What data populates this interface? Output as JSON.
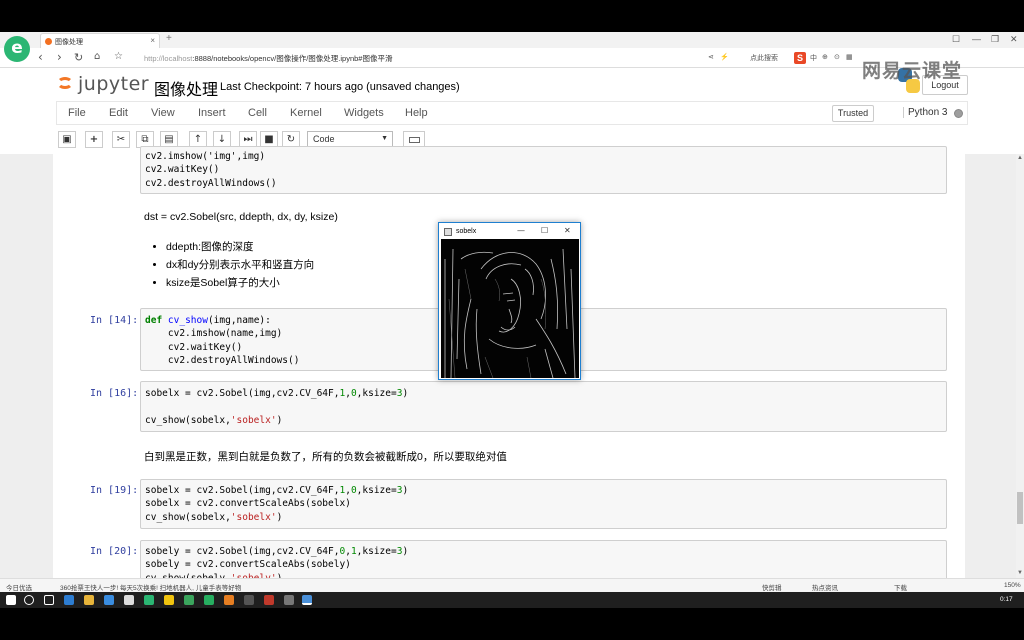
{
  "browser": {
    "tab_title": "图像处理",
    "url_host": "http://localhost",
    "url_path": ":8888/notebooks/opencv/图像操作/图像处理.ipynb#图像平滑",
    "new_tab_symbol": "+",
    "tab_close_symbol": "×",
    "right_tools": [
      "点此搜索",
      "中",
      "⊕",
      "⊙",
      "▦"
    ],
    "window_controls": [
      "☐",
      "—",
      "❐",
      "✕"
    ]
  },
  "jupyter": {
    "logo_text": "jupyter",
    "notebook_name": "图像处理",
    "checkpoint": "Last Checkpoint: 7 hours ago (unsaved changes)",
    "logout": "Logout",
    "menu": [
      "File",
      "Edit",
      "View",
      "Insert",
      "Cell",
      "Kernel",
      "Widgets",
      "Help"
    ],
    "trusted": "Trusted",
    "kernel": "Python 3",
    "cell_type": "Code",
    "toolbar_icons": [
      "save-icon",
      "plus-icon",
      "cut-icon",
      "copy-icon",
      "paste-icon",
      "arrow-up-icon",
      "arrow-down-icon",
      "run-icon",
      "stop-icon",
      "restart-icon"
    ]
  },
  "watermark": "网易云课堂",
  "cells": {
    "top_code": [
      "cv2.imshow('img',img)",
      "cv2.waitKey()",
      "cv2.destroyAllWindows()"
    ],
    "md1_heading": "dst = cv2.Sobel(src, ddepth, dx, dy, ksize)",
    "md1_bullets": [
      "ddepth:图像的深度",
      "dx和dy分别表示水平和竖直方向",
      "ksize是Sobel算子的大小"
    ],
    "c14_prompt": "In [14]:",
    "c16_prompt": "In [16]:",
    "md2_text": "白到黑是正数，黑到白就是负数了，所有的负数会被截断成0，所以要取绝对值",
    "c19_prompt": "In [19]:",
    "c20_prompt": "In [20]:"
  },
  "cv_window": {
    "title": "sobelx",
    "controls": [
      "—",
      "☐",
      "✕"
    ]
  },
  "statusbar": {
    "left": "今日优选",
    "news": "360抢票王快人一步! 每天5次换乘! 扫地机器人, 儿童手表等好物",
    "items": [
      "快剪辑",
      "热点资讯",
      "下载",
      "150%"
    ]
  },
  "taskbar": {
    "clock": "0:17"
  }
}
